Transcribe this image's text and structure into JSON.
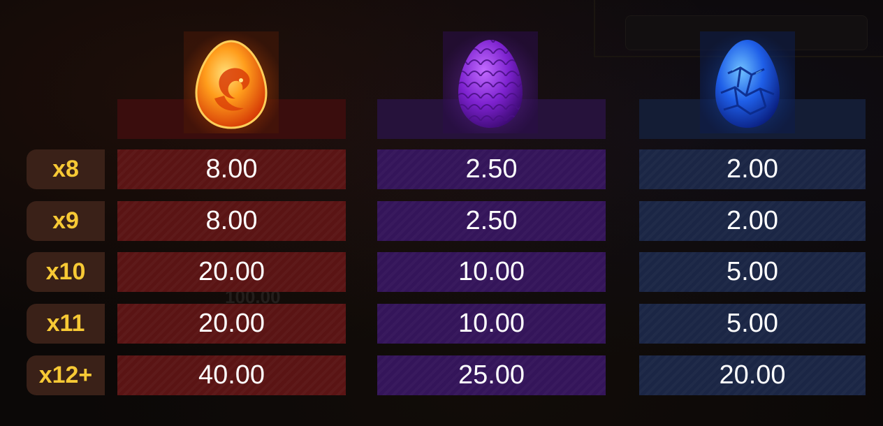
{
  "eggs": [
    {
      "name": "fire-egg",
      "color": "#f39b1e"
    },
    {
      "name": "purple-egg",
      "color": "#8a2fd8"
    },
    {
      "name": "blue-egg",
      "color": "#1f63ef"
    }
  ],
  "multipliers": [
    "x8",
    "x9",
    "x10",
    "x11",
    "x12+"
  ],
  "payouts": {
    "fire": [
      "8.00",
      "8.00",
      "20.00",
      "20.00",
      "40.00"
    ],
    "purple": [
      "2.50",
      "2.50",
      "10.00",
      "10.00",
      "25.00"
    ],
    "blue": [
      "2.00",
      "2.00",
      "5.00",
      "5.00",
      "20.00"
    ]
  },
  "background_text": "100.00",
  "colors": {
    "label_text": "#f7c935",
    "fire_cell": "#5a1414",
    "purple_cell": "#34155a",
    "blue_cell": "#1b2645"
  }
}
